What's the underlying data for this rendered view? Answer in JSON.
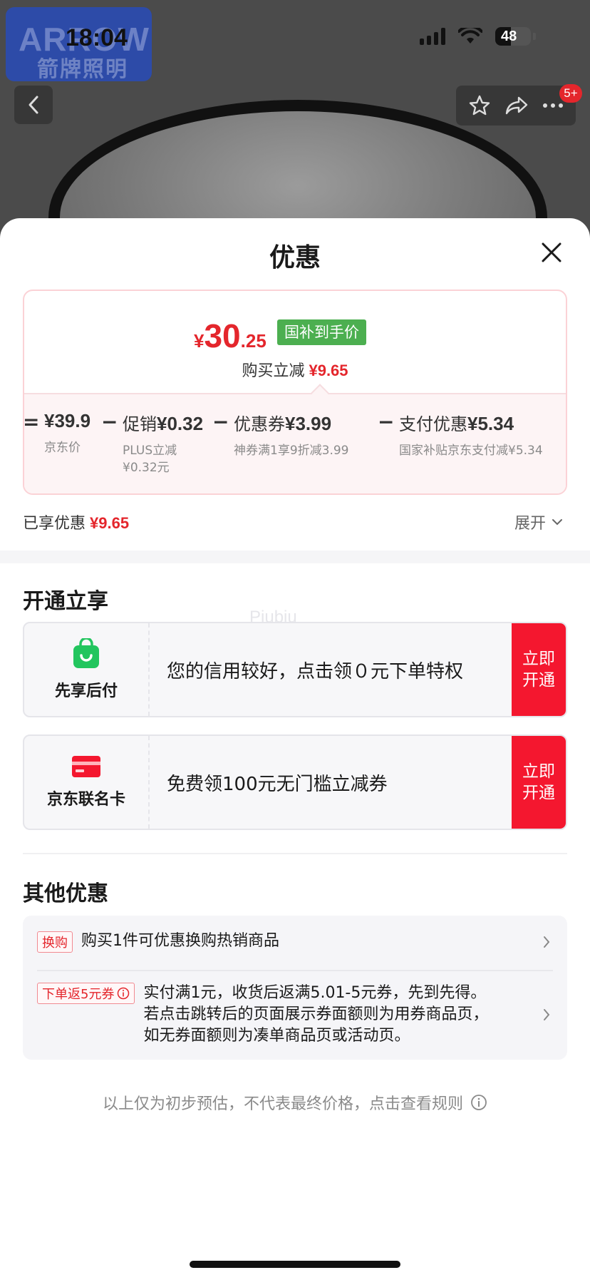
{
  "background": {
    "brand_en": "ARROW",
    "brand_cn": "箭牌照明",
    "status_time": "18:04",
    "battery": "48",
    "cart_badge": "5+"
  },
  "sheet": {
    "title": "优惠",
    "price": {
      "currency": "¥",
      "integer": "30",
      "decimal": ".25",
      "tag": "国补到手价",
      "save_label": "购买立减",
      "save_value": "¥9.65"
    },
    "breakdown": [
      {
        "op": "=",
        "label": "",
        "value": "¥39.9",
        "sub": [
          "京东价"
        ]
      },
      {
        "op": "−",
        "label": "促销",
        "value": "¥0.32",
        "sub": [
          "PLUS立减",
          "¥0.32元"
        ]
      },
      {
        "op": "−",
        "label": "优惠券",
        "value": "¥3.99",
        "sub": [
          "神券满1享9折减3.99"
        ]
      },
      {
        "op": "−",
        "label": "支付优惠",
        "value": "¥5.34",
        "sub": [
          "国家补贴京东支付减¥5.34"
        ]
      }
    ],
    "enjoyed_label": "已享优惠",
    "enjoyed_value": "¥9.65",
    "expand_label": "展开",
    "open_section_title": "开通立享",
    "watermark": "Piubiu",
    "offers": [
      {
        "name": "先享后付",
        "icon": "shopping-bag-icon",
        "icon_color": "#22c55e",
        "text": "您的信用较好，点击领０元下单特权",
        "button": "立即开通"
      },
      {
        "name": "京东联名卡",
        "icon": "credit-card-icon",
        "icon_color": "#f4172f",
        "text": "免费领100元无门槛立减券",
        "button": "立即开通"
      }
    ],
    "other_section_title": "其他优惠",
    "other_offers": [
      {
        "tag": "换购",
        "text": "购买1件可优惠换购热销商品"
      },
      {
        "tag": "下单返5元券",
        "text_lines": [
          "实付满1元，收货后返满5.01-5元券，先到先得。",
          "若点击跳转后的页面展示券面额则为用券商品页，",
          "如无券面额则为凑单商品页或活动页。"
        ]
      }
    ],
    "disclaimer": "以上仅为初步预估，不代表最终价格，点击查看规则"
  },
  "colors": {
    "accent_red": "#e4262c",
    "button_red": "#f4172f",
    "subsidy_green": "#4caf50"
  }
}
